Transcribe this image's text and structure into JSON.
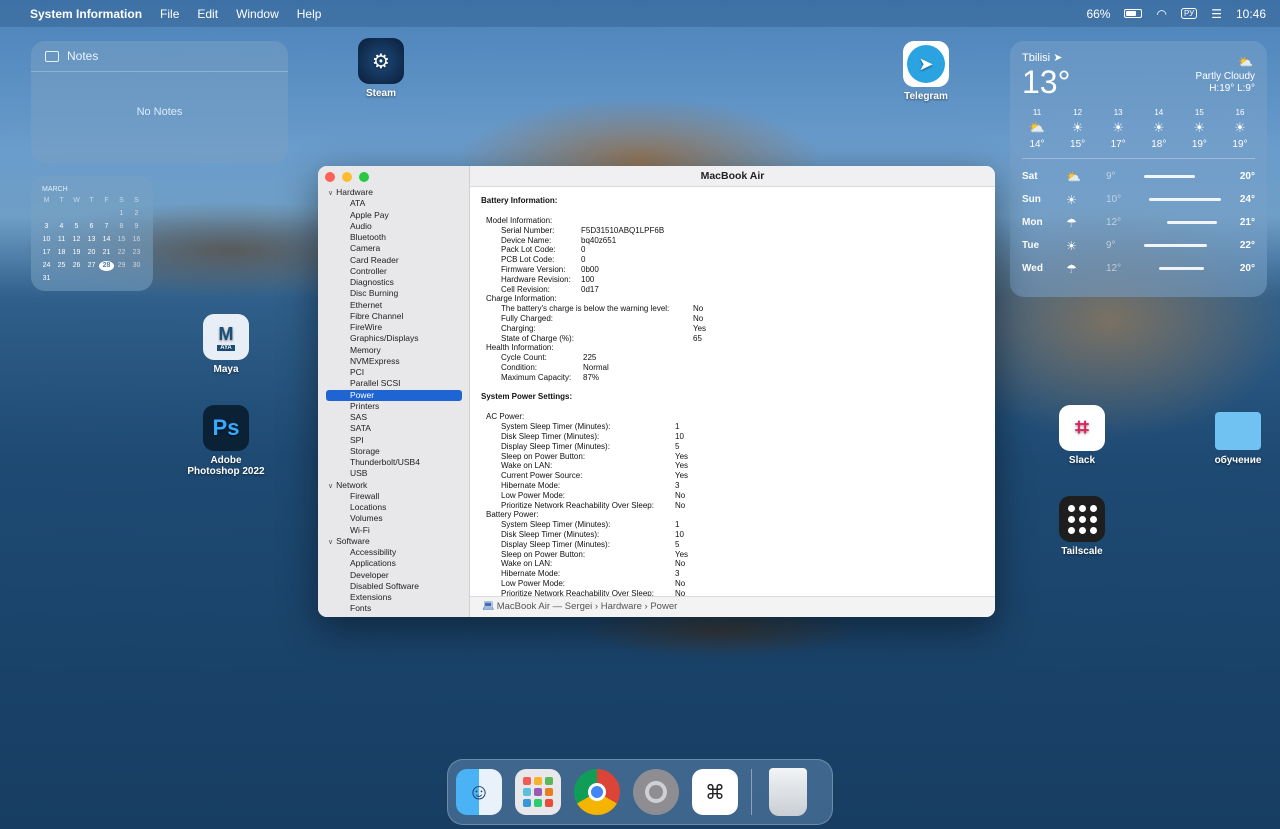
{
  "menubar": {
    "app_name": "System Information",
    "menus": [
      "File",
      "Edit",
      "Window",
      "Help"
    ],
    "battery": "66%",
    "keyboard": "РУ",
    "clock": "10:46"
  },
  "notes_widget": {
    "title": "Notes",
    "empty_text": "No Notes"
  },
  "calendar_widget": {
    "month": "MARCH",
    "weekdays": [
      "M",
      "T",
      "W",
      "T",
      "F",
      "S",
      "S"
    ],
    "weeks": [
      [
        "",
        "",
        "",
        "",
        "",
        "1",
        "2"
      ],
      [
        "3",
        "4",
        "5",
        "6",
        "7",
        "8",
        "9"
      ],
      [
        "10",
        "11",
        "12",
        "13",
        "14",
        "15",
        "16"
      ],
      [
        "17",
        "18",
        "19",
        "20",
        "21",
        "22",
        "23"
      ],
      [
        "24",
        "25",
        "26",
        "27",
        "28",
        "29",
        "30"
      ],
      [
        "31",
        "",
        "",
        "",
        "",
        "",
        ""
      ]
    ],
    "today": "28"
  },
  "weather_widget": {
    "city": "Tbilisi",
    "temp": "13°",
    "condition": "Partly Cloudy",
    "hi_lo": "H:19° L:9°",
    "hourly": [
      {
        "hour": "11",
        "icon": "partly-cloudy",
        "temp": "14°"
      },
      {
        "hour": "12",
        "icon": "sun",
        "temp": "15°"
      },
      {
        "hour": "13",
        "icon": "sun",
        "temp": "17°"
      },
      {
        "hour": "14",
        "icon": "sun",
        "temp": "18°"
      },
      {
        "hour": "15",
        "icon": "sun",
        "temp": "19°"
      },
      {
        "hour": "16",
        "icon": "sun",
        "temp": "19°"
      }
    ],
    "daily": [
      {
        "day": "Sat",
        "icon": "partly-cloudy",
        "low": "9°",
        "high": "20°"
      },
      {
        "day": "Sun",
        "icon": "sun",
        "low": "10°",
        "high": "24°"
      },
      {
        "day": "Mon",
        "icon": "rain",
        "low": "12°",
        "high": "21°"
      },
      {
        "day": "Tue",
        "icon": "sun",
        "low": "9°",
        "high": "22°"
      },
      {
        "day": "Wed",
        "icon": "rain",
        "low": "12°",
        "high": "20°"
      }
    ]
  },
  "desktop_icons": {
    "steam": "Steam",
    "telegram": "Telegram",
    "maya": "Maya",
    "maya_badge": "AYA",
    "photoshop_line1": "Adobe",
    "photoshop_line2": "Photoshop 2022",
    "slack": "Slack",
    "tailscale": "Tailscale",
    "folder": "обучение"
  },
  "window": {
    "title": "MacBook Air",
    "path": "MacBook Air — Sergei › Hardware › Power",
    "sidebar": {
      "hardware": "Hardware",
      "hardware_items": [
        "ATA",
        "Apple Pay",
        "Audio",
        "Bluetooth",
        "Camera",
        "Card Reader",
        "Controller",
        "Diagnostics",
        "Disc Burning",
        "Ethernet",
        "Fibre Channel",
        "FireWire",
        "Graphics/Displays",
        "Memory",
        "NVMExpress",
        "PCI",
        "Parallel SCSI",
        "Power",
        "Printers",
        "SAS",
        "SATA",
        "SPI",
        "Storage",
        "Thunderbolt/USB4",
        "USB"
      ],
      "selected": "Power",
      "network": "Network",
      "network_items": [
        "Firewall",
        "Locations",
        "Volumes",
        "Wi-Fi"
      ],
      "software": "Software",
      "software_items": [
        "Accessibility",
        "Applications",
        "Developer",
        "Disabled Software",
        "Extensions",
        "Fonts"
      ]
    },
    "content": {
      "battery_heading": "Battery Information:",
      "model_heading": "Model Information:",
      "model": [
        [
          "Serial Number:",
          "F5D31510ABQ1LPF6B"
        ],
        [
          "Device Name:",
          "bq40z651"
        ],
        [
          "Pack Lot Code:",
          "0"
        ],
        [
          "PCB Lot Code:",
          "0"
        ],
        [
          "Firmware Version:",
          "0b00"
        ],
        [
          "Hardware Revision:",
          "100"
        ],
        [
          "Cell Revision:",
          "0d17"
        ]
      ],
      "charge_heading": "Charge Information:",
      "charge": [
        [
          "The battery's charge is below the warning level:",
          "No"
        ],
        [
          "Fully Charged:",
          "No"
        ],
        [
          "Charging:",
          "Yes"
        ],
        [
          "State of Charge (%):",
          "65"
        ]
      ],
      "health_heading": "Health Information:",
      "health": [
        [
          "Cycle Count:",
          "225"
        ],
        [
          "Condition:",
          "Normal"
        ],
        [
          "Maximum Capacity:",
          "87%"
        ]
      ],
      "power_heading": "System Power Settings:",
      "ac_heading": "AC Power:",
      "ac": [
        [
          "System Sleep Timer (Minutes):",
          "1"
        ],
        [
          "Disk Sleep Timer (Minutes):",
          "10"
        ],
        [
          "Display Sleep Timer (Minutes):",
          "5"
        ],
        [
          "Sleep on Power Button:",
          "Yes"
        ],
        [
          "Wake on LAN:",
          "Yes"
        ],
        [
          "Current Power Source:",
          "Yes"
        ],
        [
          "Hibernate Mode:",
          "3"
        ],
        [
          "Low Power Mode:",
          "No"
        ],
        [
          "Prioritize Network Reachability Over Sleep:",
          "No"
        ]
      ],
      "batt_heading": "Battery Power:",
      "battery_power": [
        [
          "System Sleep Timer (Minutes):",
          "1"
        ],
        [
          "Disk Sleep Timer (Minutes):",
          "10"
        ],
        [
          "Display Sleep Timer (Minutes):",
          "5"
        ],
        [
          "Sleep on Power Button:",
          "Yes"
        ],
        [
          "Wake on LAN:",
          "No"
        ],
        [
          "Hibernate Mode:",
          "3"
        ],
        [
          "Low Power Mode:",
          "No"
        ],
        [
          "Prioritize Network Reachability Over Sleep:",
          "No"
        ]
      ]
    }
  },
  "dock": [
    "finder-icon",
    "launchpad-icon",
    "chrome-icon",
    "system-preferences-icon",
    "system-information-icon",
    "trash-icon"
  ]
}
